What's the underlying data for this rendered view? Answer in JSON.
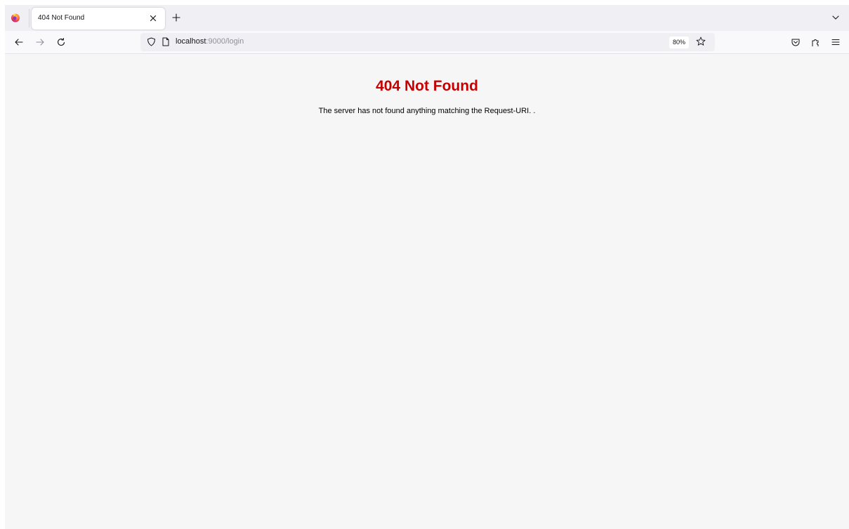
{
  "browser": {
    "tab": {
      "title": "404 Not Found"
    },
    "address_bar": {
      "host": "localhost",
      "rest": ":9000/login"
    },
    "zoom_level": "80%"
  },
  "page": {
    "heading": "404 Not Found",
    "message": "The server has not found anything matching the Request-URI. ."
  },
  "colors": {
    "heading": "#c60000",
    "content_background": "#f6f6f6",
    "tabstrip_background": "#f0f0f4"
  },
  "icons": [
    "firefox-logo-icon",
    "close-icon",
    "plus-icon",
    "chevron-down-icon",
    "back-arrow-icon",
    "forward-arrow-icon",
    "reload-icon",
    "shield-icon",
    "page-icon",
    "star-icon",
    "pocket-icon",
    "extensions-icon",
    "hamburger-menu-icon"
  ]
}
